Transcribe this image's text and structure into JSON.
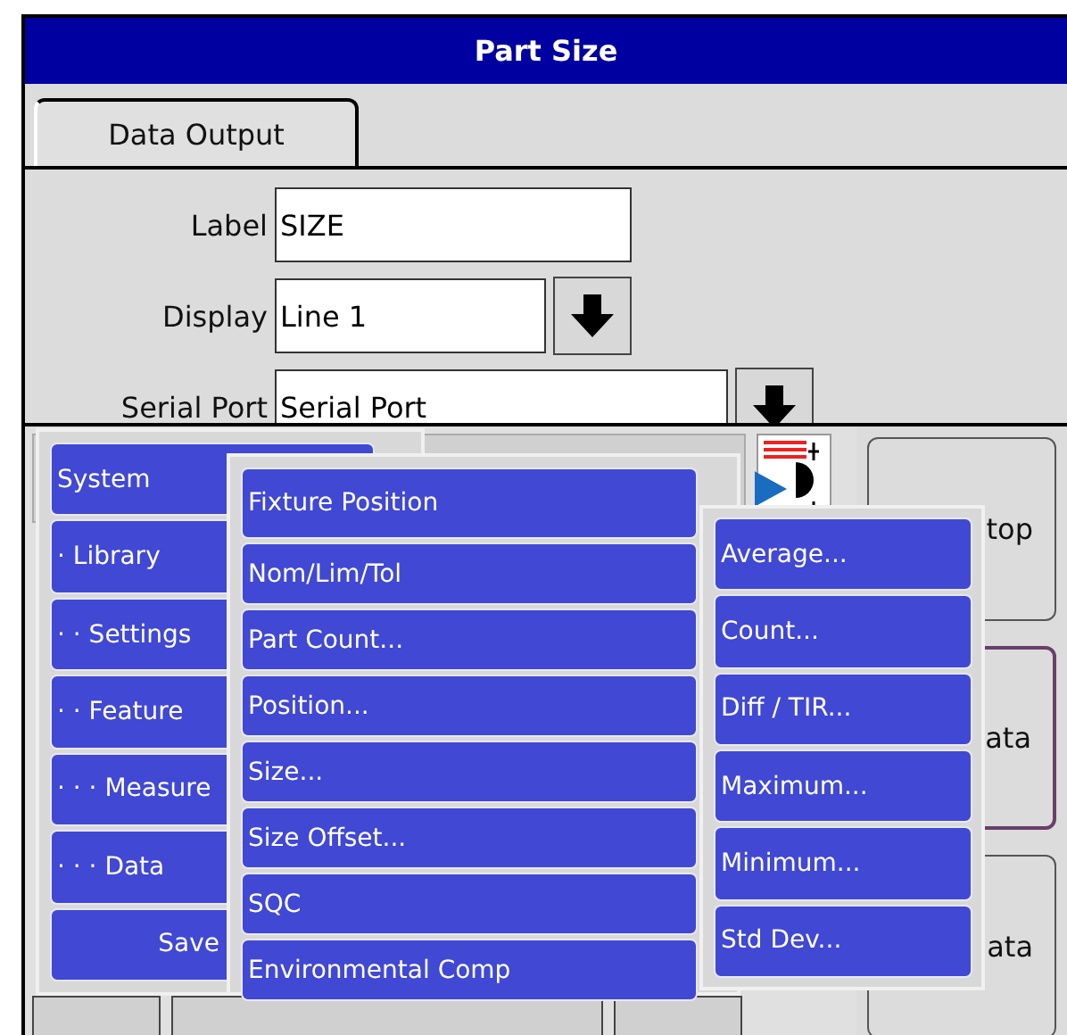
{
  "window": {
    "title": "Part Size"
  },
  "tabs": [
    {
      "label": "Data Output",
      "selected": true
    }
  ],
  "form": {
    "fields": [
      {
        "label": "Label",
        "value": "SIZE",
        "kind": "text"
      },
      {
        "label": "Display",
        "value": "Line 1",
        "kind": "dropdown"
      },
      {
        "label": "Serial Port",
        "value": "Serial Port",
        "kind": "dropdown"
      }
    ]
  },
  "side_buttons": [
    {
      "label": "top",
      "selected": false
    },
    {
      "label": "ata",
      "selected": true
    },
    {
      "label": "ata",
      "selected": false
    }
  ],
  "menu": {
    "items": [
      {
        "label": "System",
        "kind": "item"
      },
      {
        "label": "· Library",
        "kind": "item"
      },
      {
        "label": "· · Settings",
        "kind": "item"
      },
      {
        "label": "· · Feature",
        "kind": "item"
      },
      {
        "label": "· · · Measure",
        "kind": "item"
      },
      {
        "label": "· · · Data",
        "kind": "item"
      },
      {
        "label": "Save",
        "kind": "action"
      }
    ]
  },
  "submenu": {
    "items": [
      {
        "label": "Fixture Position",
        "expanded": true
      },
      {
        "label": "Nom/Lim/Tol",
        "expanded": false
      },
      {
        "label": "Part Count...",
        "expanded": false
      },
      {
        "label": "Position...",
        "expanded": false
      },
      {
        "label": "Size...",
        "expanded": false
      },
      {
        "label": "Size Offset...",
        "expanded": false
      },
      {
        "label": "SQC",
        "expanded": false
      },
      {
        "label": "Environmental Comp",
        "expanded": false
      }
    ]
  },
  "submenu_2": {
    "items": [
      {
        "label": "Average..."
      },
      {
        "label": "Count..."
      },
      {
        "label": "Diff / TIR..."
      },
      {
        "label": "Maximum..."
      },
      {
        "label": "Minimum..."
      },
      {
        "label": "Std Dev..."
      }
    ]
  }
}
